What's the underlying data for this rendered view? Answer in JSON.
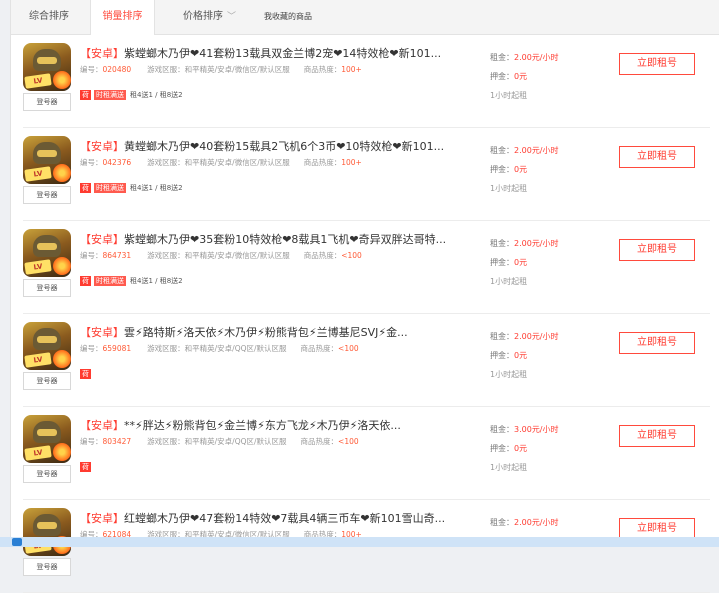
{
  "tabs": [
    {
      "label": "综合排序"
    },
    {
      "label": "销量排序"
    },
    {
      "label": "价格排序"
    },
    {
      "label": "我收藏的商品"
    }
  ],
  "labels": {
    "login": "登号器",
    "rent": "立即租号",
    "code_prefix": "编号：",
    "region_prefix": "游戏区服：",
    "heat_prefix": "商品热度：",
    "price_prefix": "租金：",
    "deposit_prefix": "押金：",
    "avatar_badge": "LV"
  },
  "items": [
    {
      "tag": "【安卓】",
      "title": "紫螳螂木乃伊❤41套粉13载具双金兰博2宠❤14特效枪❤新101...",
      "code": "020480",
      "region": "和平精英/安卓/微信区/默认区服",
      "heat": "100+",
      "badge1": "荷",
      "badge2": "时租满送",
      "promo": "租4送1 / 租8送2",
      "price": "2.00元/小时",
      "deposit": "0元",
      "min": "1小时起租"
    },
    {
      "tag": "【安卓】",
      "title": "黄螳螂木乃伊❤40套粉15载具2飞机6个3币❤10特效枪❤新101...",
      "code": "042376",
      "region": "和平精英/安卓/微信区/默认区服",
      "heat": "100+",
      "badge1": "荷",
      "badge2": "时租满送",
      "promo": "租4送1 / 租8送2",
      "price": "2.00元/小时",
      "deposit": "0元",
      "min": "1小时起租"
    },
    {
      "tag": "【安卓】",
      "title": "紫螳螂木乃伊❤35套粉10特效枪❤8载具1飞机❤奇异双胖达哥特...",
      "code": "864731",
      "region": "和平精英/安卓/微信区/默认区服",
      "heat": "<100",
      "badge1": "荷",
      "badge2": "时租满送",
      "promo": "租4送1 / 租8送2",
      "price": "2.00元/小时",
      "deposit": "0元",
      "min": "1小时起租"
    },
    {
      "tag": "【安卓】",
      "title": "雲⚡路特斯⚡洛天依⚡木乃伊⚡粉熊背包⚡兰博基尼SVJ⚡金...",
      "code": "659081",
      "region": "和平精英/安卓/QQ区/默认区服",
      "heat": "<100",
      "badge1": "荷",
      "badge2": "",
      "promo": "",
      "price": "2.00元/小时",
      "deposit": "0元",
      "min": "1小时起租"
    },
    {
      "tag": "【安卓】",
      "title": "**⚡胖达⚡粉熊背包⚡金兰博⚡东方飞龙⚡木乃伊⚡洛天依...",
      "code": "803427",
      "region": "和平精英/安卓/QQ区/默认区服",
      "heat": "<100",
      "badge1": "荷",
      "badge2": "",
      "promo": "",
      "price": "3.00元/小时",
      "deposit": "0元",
      "min": "1小时起租"
    },
    {
      "tag": "【安卓】",
      "title": "红螳螂木乃伊❤47套粉14特效❤7载具4辆三币车❤新101雪山奇...",
      "code": "621084",
      "region": "和平精英/安卓/微信区/默认区服",
      "heat": "100+",
      "badge1": "",
      "badge2": "",
      "promo": "",
      "price": "2.00元/小时",
      "deposit": "",
      "min": ""
    }
  ]
}
